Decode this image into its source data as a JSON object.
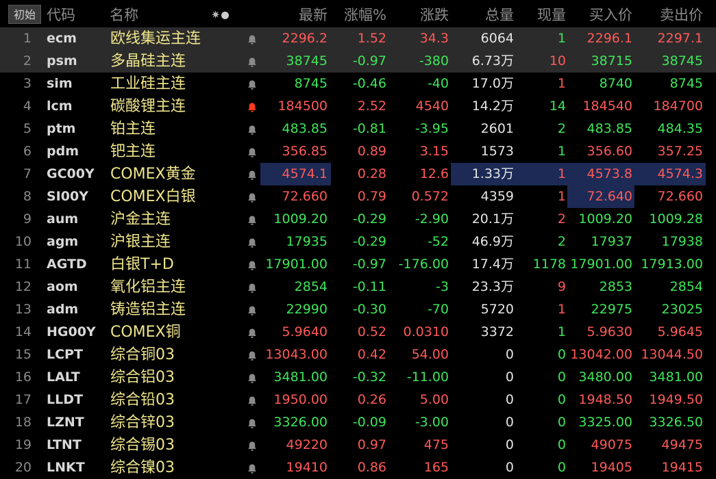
{
  "header": {
    "init_button": "初始",
    "code": "代码",
    "name": "名称",
    "icons": "✷●",
    "last": "最新",
    "pct": "涨幅%",
    "change": "涨跌",
    "volume": "总量",
    "current_vol": "现量",
    "bid": "买入价",
    "ask": "卖出价"
  },
  "colors": {
    "up": "#ff5a5a",
    "down": "#3ee65a",
    "name": "#f0e68c",
    "selected_row": "#2b2b2b",
    "highlight": "#1c2a55",
    "bell_active": "#ff3b1f",
    "bell_idle": "#8a8a8a"
  },
  "rows": [
    {
      "idx": "1",
      "code": "ecm",
      "name": "欧线集运主连",
      "bell": "idle",
      "last": "2296.2",
      "pct": "1.52",
      "change": "34.3",
      "volume": "6064",
      "current": "1",
      "bid": "2296.1",
      "ask": "2297.1",
      "dir": "up",
      "cur_dir": "down",
      "bid_dir": "up",
      "ask_dir": "up",
      "selected": true
    },
    {
      "idx": "2",
      "code": "psm",
      "name": "多晶硅主连",
      "bell": "idle",
      "last": "38745",
      "pct": "-0.97",
      "change": "-380",
      "volume": "6.73万",
      "current": "10",
      "bid": "38715",
      "ask": "38745",
      "dir": "down",
      "cur_dir": "up",
      "bid_dir": "down",
      "ask_dir": "down",
      "selected": true
    },
    {
      "idx": "3",
      "code": "sim",
      "name": "工业硅主连",
      "bell": "idle",
      "last": "8745",
      "pct": "-0.46",
      "change": "-40",
      "volume": "17.0万",
      "current": "1",
      "bid": "8740",
      "ask": "8745",
      "dir": "down",
      "cur_dir": "up",
      "bid_dir": "down",
      "ask_dir": "down"
    },
    {
      "idx": "4",
      "code": "lcm",
      "name": "碳酸锂主连",
      "bell": "active",
      "last": "184500",
      "pct": "2.52",
      "change": "4540",
      "volume": "14.2万",
      "current": "14",
      "bid": "184540",
      "ask": "184700",
      "dir": "up",
      "cur_dir": "down",
      "bid_dir": "up",
      "ask_dir": "up"
    },
    {
      "idx": "5",
      "code": "ptm",
      "name": "铂主连",
      "bell": "idle",
      "last": "483.85",
      "pct": "-0.81",
      "change": "-3.95",
      "volume": "2601",
      "current": "2",
      "bid": "483.85",
      "ask": "484.35",
      "dir": "down",
      "cur_dir": "down",
      "bid_dir": "down",
      "ask_dir": "down"
    },
    {
      "idx": "6",
      "code": "pdm",
      "name": "钯主连",
      "bell": "idle",
      "last": "356.85",
      "pct": "0.89",
      "change": "3.15",
      "volume": "1573",
      "current": "1",
      "bid": "356.60",
      "ask": "357.25",
      "dir": "up",
      "cur_dir": "down",
      "bid_dir": "up",
      "ask_dir": "up"
    },
    {
      "idx": "7",
      "code": "GC00Y",
      "name": "COMEX黄金",
      "bell": "idle",
      "last": "4574.1",
      "pct": "0.28",
      "change": "12.6",
      "volume": "1.33万",
      "current": "1",
      "bid": "4573.8",
      "ask": "4574.3",
      "dir": "up",
      "cur_dir": "up",
      "bid_dir": "up",
      "ask_dir": "up",
      "hl": "last-vol"
    },
    {
      "idx": "8",
      "code": "SI00Y",
      "name": "COMEX白银",
      "bell": "idle",
      "last": "72.660",
      "pct": "0.79",
      "change": "0.572",
      "volume": "4359",
      "current": "1",
      "bid": "72.640",
      "ask": "72.660",
      "dir": "up",
      "cur_dir": "up",
      "bid_dir": "up",
      "ask_dir": "up",
      "hl": "bid"
    },
    {
      "idx": "9",
      "code": "aum",
      "name": "沪金主连",
      "bell": "idle",
      "last": "1009.20",
      "pct": "-0.29",
      "change": "-2.90",
      "volume": "20.1万",
      "current": "2",
      "bid": "1009.20",
      "ask": "1009.28",
      "dir": "down",
      "cur_dir": "up",
      "bid_dir": "down",
      "ask_dir": "down"
    },
    {
      "idx": "10",
      "code": "agm",
      "name": "沪银主连",
      "bell": "idle",
      "last": "17935",
      "pct": "-0.29",
      "change": "-52",
      "volume": "46.9万",
      "current": "2",
      "bid": "17937",
      "ask": "17938",
      "dir": "down",
      "cur_dir": "down",
      "bid_dir": "down",
      "ask_dir": "down"
    },
    {
      "idx": "11",
      "code": "AGTD",
      "name": "白银T+D",
      "bell": "idle",
      "last": "17901.00",
      "pct": "-0.97",
      "change": "-176.00",
      "volume": "17.4万",
      "current": "1178",
      "bid": "17901.00",
      "ask": "17913.00",
      "dir": "down",
      "cur_dir": "down",
      "bid_dir": "down",
      "ask_dir": "down"
    },
    {
      "idx": "12",
      "code": "aom",
      "name": "氧化铝主连",
      "bell": "idle",
      "last": "2854",
      "pct": "-0.11",
      "change": "-3",
      "volume": "23.3万",
      "current": "9",
      "bid": "2853",
      "ask": "2854",
      "dir": "down",
      "cur_dir": "up",
      "bid_dir": "down",
      "ask_dir": "down"
    },
    {
      "idx": "13",
      "code": "adm",
      "name": "铸造铝主连",
      "bell": "idle",
      "last": "22990",
      "pct": "-0.30",
      "change": "-70",
      "volume": "5720",
      "current": "1",
      "bid": "22975",
      "ask": "23025",
      "dir": "down",
      "cur_dir": "up",
      "bid_dir": "down",
      "ask_dir": "down"
    },
    {
      "idx": "14",
      "code": "HG00Y",
      "name": "COMEX铜",
      "bell": "idle",
      "last": "5.9640",
      "pct": "0.52",
      "change": "0.0310",
      "volume": "3372",
      "current": "1",
      "bid": "5.9630",
      "ask": "5.9645",
      "dir": "up",
      "cur_dir": "down",
      "bid_dir": "up",
      "ask_dir": "up"
    },
    {
      "idx": "15",
      "code": "LCPT",
      "name": "综合铜03",
      "bell": "idle",
      "last": "13043.00",
      "pct": "0.42",
      "change": "54.00",
      "volume": "0",
      "current": "0",
      "bid": "13042.00",
      "ask": "13044.50",
      "dir": "up",
      "cur_dir": "down",
      "bid_dir": "up",
      "ask_dir": "up"
    },
    {
      "idx": "16",
      "code": "LALT",
      "name": "综合铝03",
      "bell": "idle",
      "last": "3481.00",
      "pct": "-0.32",
      "change": "-11.00",
      "volume": "0",
      "current": "0",
      "bid": "3480.00",
      "ask": "3481.00",
      "dir": "down",
      "cur_dir": "down",
      "bid_dir": "down",
      "ask_dir": "down"
    },
    {
      "idx": "17",
      "code": "LLDT",
      "name": "综合铅03",
      "bell": "idle",
      "last": "1950.00",
      "pct": "0.26",
      "change": "5.00",
      "volume": "0",
      "current": "0",
      "bid": "1948.50",
      "ask": "1949.50",
      "dir": "up",
      "cur_dir": "down",
      "bid_dir": "up",
      "ask_dir": "up"
    },
    {
      "idx": "18",
      "code": "LZNT",
      "name": "综合锌03",
      "bell": "idle",
      "last": "3326.00",
      "pct": "-0.09",
      "change": "-3.00",
      "volume": "0",
      "current": "0",
      "bid": "3325.00",
      "ask": "3326.50",
      "dir": "down",
      "cur_dir": "down",
      "bid_dir": "down",
      "ask_dir": "down"
    },
    {
      "idx": "19",
      "code": "LTNT",
      "name": "综合锡03",
      "bell": "idle",
      "last": "49220",
      "pct": "0.97",
      "change": "475",
      "volume": "0",
      "current": "0",
      "bid": "49075",
      "ask": "49475",
      "dir": "up",
      "cur_dir": "down",
      "bid_dir": "up",
      "ask_dir": "up"
    },
    {
      "idx": "20",
      "code": "LNKT",
      "name": "综合镍03",
      "bell": "idle",
      "last": "19410",
      "pct": "0.86",
      "change": "165",
      "volume": "0",
      "current": "0",
      "bid": "19405",
      "ask": "19415",
      "dir": "up",
      "cur_dir": "down",
      "bid_dir": "up",
      "ask_dir": "up"
    }
  ]
}
